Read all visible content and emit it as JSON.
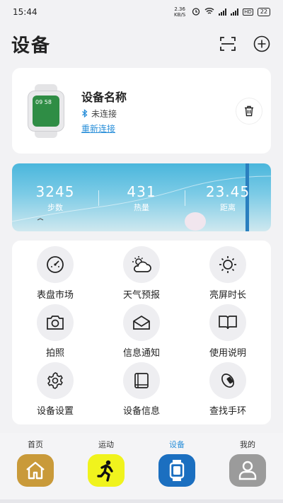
{
  "status_bar": {
    "time": "15:44",
    "net_speed": "2.36 KB/S",
    "battery": "22"
  },
  "header": {
    "title": "设备"
  },
  "device": {
    "name": "设备名称",
    "status": "未连接",
    "reconnect": "重新连接",
    "watch_time": "09 58"
  },
  "stats": [
    {
      "value": "3245",
      "label": "步数"
    },
    {
      "value": "431",
      "label": "热量"
    },
    {
      "value": "23.45",
      "label": "距离"
    }
  ],
  "features": [
    {
      "label": "表盘市场",
      "icon": "dial-icon"
    },
    {
      "label": "天气预报",
      "icon": "weather-icon"
    },
    {
      "label": "亮屏时长",
      "icon": "brightness-icon"
    },
    {
      "label": "拍照",
      "icon": "camera-icon"
    },
    {
      "label": "信息通知",
      "icon": "mail-icon"
    },
    {
      "label": "使用说明",
      "icon": "book-icon"
    },
    {
      "label": "设备设置",
      "icon": "settings-icon"
    },
    {
      "label": "设备信息",
      "icon": "device-info-icon"
    },
    {
      "label": "查找手环",
      "icon": "band-icon"
    }
  ],
  "nav": [
    {
      "label": "首页",
      "icon": "home-icon",
      "color": "#c99a3a"
    },
    {
      "label": "运动",
      "icon": "run-icon",
      "color": "#f0f31d"
    },
    {
      "label": "设备",
      "icon": "watch-icon",
      "color": "#1b6fc0",
      "active": true
    },
    {
      "label": "我的",
      "icon": "user-icon",
      "color": "#9b9b9b"
    }
  ]
}
